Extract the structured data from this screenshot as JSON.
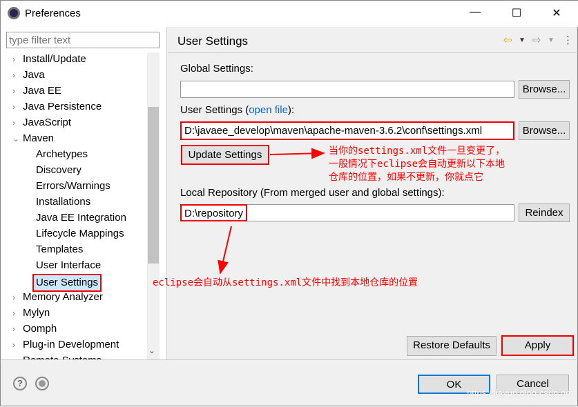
{
  "window": {
    "title": "Preferences",
    "minimize": "—",
    "maximize": "☐",
    "close": "✕"
  },
  "filter": {
    "placeholder": "type filter text"
  },
  "tree": [
    {
      "label": "Install/Update",
      "level": 0,
      "expand": "›"
    },
    {
      "label": "Java",
      "level": 0,
      "expand": "›"
    },
    {
      "label": "Java EE",
      "level": 0,
      "expand": "›"
    },
    {
      "label": "Java Persistence",
      "level": 0,
      "expand": "›"
    },
    {
      "label": "JavaScript",
      "level": 0,
      "expand": "›"
    },
    {
      "label": "Maven",
      "level": 0,
      "expand": "⌄"
    },
    {
      "label": "Archetypes",
      "level": 1
    },
    {
      "label": "Discovery",
      "level": 1
    },
    {
      "label": "Errors/Warnings",
      "level": 1
    },
    {
      "label": "Installations",
      "level": 1
    },
    {
      "label": "Java EE Integration",
      "level": 1
    },
    {
      "label": "Lifecycle Mappings",
      "level": 1
    },
    {
      "label": "Templates",
      "level": 1
    },
    {
      "label": "User Interface",
      "level": 1
    },
    {
      "label": "User Settings",
      "level": 1,
      "selected": true
    },
    {
      "label": "Memory Analyzer",
      "level": 0,
      "expand": "›"
    },
    {
      "label": "Mylyn",
      "level": 0,
      "expand": "›"
    },
    {
      "label": "Oomph",
      "level": 0,
      "expand": "›"
    },
    {
      "label": "Plug-in Development",
      "level": 0,
      "expand": "›"
    },
    {
      "label": "Remote Systems",
      "level": 0,
      "expand": "›"
    }
  ],
  "page": {
    "title": "User Settings",
    "global_label": "Global Settings:",
    "global_value": "",
    "browse": "Browse...",
    "user_label_pre": "User Settings (",
    "user_link": "open file",
    "user_label_post": "):",
    "user_value": "D:\\javaee_develop\\maven\\apache-maven-3.6.2\\conf\\settings.xml",
    "update": "Update Settings",
    "local_label": "Local Repository (From merged user and global settings):",
    "local_value": "D:\\repository",
    "reindex": "Reindex",
    "restore": "Restore Defaults",
    "apply": "Apply"
  },
  "annotations": {
    "note1": [
      "当你的settings.xml文件一旦变更了，",
      "一般情况下eclipse会自动更新以下本地",
      "仓库的位置，如果不更新，你就点它"
    ],
    "note2": "eclipse会自动从settings.xml文件中找到本地仓库的位置",
    "color": "#ff0000"
  },
  "footer": {
    "help": "?",
    "ok": "OK",
    "cancel": "Cancel",
    "watermark": "https://liayun.blog.csdn.net"
  }
}
